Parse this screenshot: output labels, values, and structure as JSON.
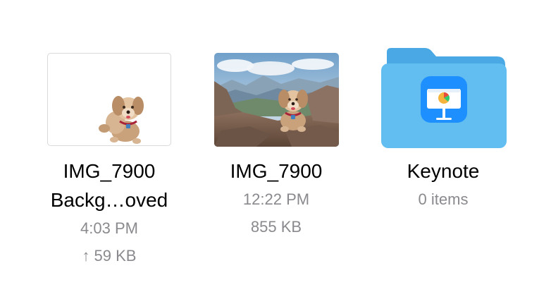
{
  "items": [
    {
      "kind": "image",
      "title_line1": "IMG_7900",
      "title_line2": "Backg…oved",
      "time": "4:03 PM",
      "upload_icon": "up-arrow-icon",
      "size": "59 KB",
      "thumbnail_icon": "dog-cutout-thumbnail"
    },
    {
      "kind": "image",
      "title_line1": "IMG_7900",
      "time": "12:22 PM",
      "size": "855 KB",
      "thumbnail_icon": "dog-on-rocks-photo-thumbnail"
    },
    {
      "kind": "folder",
      "title_line1": "Keynote",
      "count": "0 items",
      "folder_color": "#5ab4ea",
      "app_icon": "keynote-icon"
    }
  ],
  "colors": {
    "title_text": "#000000",
    "meta_text": "#8a8a8e",
    "folder_back": "#4aa8e4",
    "folder_front": "#62bdf0",
    "keynote_bg": "#1e8fff"
  }
}
